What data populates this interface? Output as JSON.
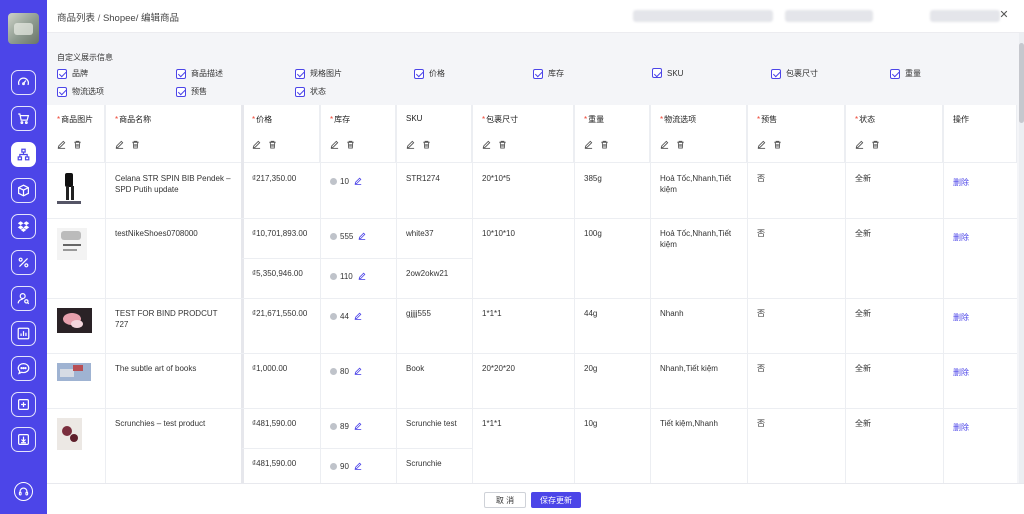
{
  "header": {
    "breadcrumb": [
      "商品列表",
      "Shopee/",
      "编辑商品"
    ],
    "separator": "/"
  },
  "settings": {
    "title": "自定义展示信息",
    "options": [
      "品牌",
      "商品描述",
      "规格图片",
      "价格",
      "库存",
      "SKU",
      "包裹尺寸",
      "重量",
      "物流选项",
      "预售",
      "状态"
    ]
  },
  "table": {
    "columns": [
      {
        "label": "商品图片",
        "required": true
      },
      {
        "label": "商品名称",
        "required": true
      },
      {
        "label": "价格",
        "required": true
      },
      {
        "label": "库存",
        "required": true
      },
      {
        "label": "SKU",
        "required": false
      },
      {
        "label": "包裹尺寸",
        "required": true
      },
      {
        "label": "重量",
        "required": true
      },
      {
        "label": "物流选项",
        "required": true
      },
      {
        "label": "预售",
        "required": true
      },
      {
        "label": "状态",
        "required": true
      },
      {
        "label": "操作",
        "required": false
      }
    ],
    "required_mark": "*",
    "rows": [
      {
        "name": "Celana STR SPIN BIB Pendek – SPD Putih update",
        "variants": [
          {
            "price": "₫217,350.00",
            "stock": "10",
            "sku": "STR1274"
          }
        ],
        "package": "20*10*5",
        "weight": "385g",
        "logistics": "Hoả Tốc,Nhanh,Tiết kiệm",
        "preorder": "否",
        "status": "全新",
        "action": "删除"
      },
      {
        "name": "testNikeShoes0708000",
        "variants": [
          {
            "price": "₫10,701,893.00",
            "stock": "555",
            "sku": "white37"
          },
          {
            "price": "₫5,350,946.00",
            "stock": "110",
            "sku": "2ow2okw21"
          }
        ],
        "package": "10*10*10",
        "weight": "100g",
        "logistics": "Hoả Tốc,Nhanh,Tiết kiệm",
        "preorder": "否",
        "status": "全新",
        "action": "删除"
      },
      {
        "name": "TEST FOR BIND PRODCUT 727",
        "variants": [
          {
            "price": "₫21,671,550.00",
            "stock": "44",
            "sku": "gjjjj555"
          }
        ],
        "package": "1*1*1",
        "weight": "44g",
        "logistics": "Nhanh",
        "preorder": "否",
        "status": "全新",
        "action": "删除"
      },
      {
        "name": "The subtle art of books",
        "variants": [
          {
            "price": "₫1,000.00",
            "stock": "80",
            "sku": "Book"
          }
        ],
        "package": "20*20*20",
        "weight": "20g",
        "logistics": "Nhanh,Tiết kiệm",
        "preorder": "否",
        "status": "全新",
        "action": "删除"
      },
      {
        "name": "Scrunchies – test product",
        "variants": [
          {
            "price": "₫481,590.00",
            "stock": "89",
            "sku": "Scrunchie test"
          },
          {
            "price": "₫481,590.00",
            "stock": "90",
            "sku": "Scrunchie"
          }
        ],
        "package": "1*1*1",
        "weight": "10g",
        "logistics": "Tiết kiệm,Nhanh",
        "preorder": "否",
        "status": "全新",
        "action": "删除"
      }
    ]
  },
  "footer": {
    "cancel_label": "取 消",
    "save_label": "保存更新"
  },
  "colors": {
    "accent": "#4c45e8",
    "required": "#ee4433"
  },
  "sidebar": {
    "icons": [
      "dashboard-icon",
      "cart-icon",
      "sitemap-icon",
      "box-icon",
      "dropbox-icon",
      "percent-icon",
      "user-search-icon",
      "bar-chart-icon",
      "chat-icon",
      "plus-square-icon",
      "download-icon",
      "headset-icon"
    ]
  }
}
